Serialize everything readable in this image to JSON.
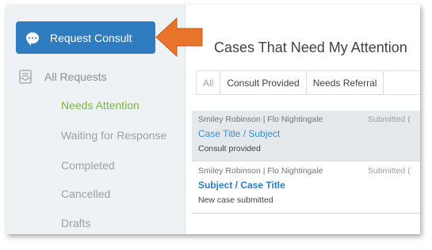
{
  "sidebar": {
    "request_button_label": "Request Consult",
    "all_requests_label": "All Requests",
    "items": [
      {
        "label": "Needs Attention",
        "active": true
      },
      {
        "label": "Waiting for Response",
        "active": false
      },
      {
        "label": "Completed",
        "active": false
      },
      {
        "label": "Cancelled",
        "active": false
      },
      {
        "label": "Drafts",
        "active": false
      }
    ]
  },
  "main": {
    "title": "Cases That Need My Attention",
    "tabs": [
      {
        "label": "All"
      },
      {
        "label": "Consult Provided"
      },
      {
        "label": "Needs Referral"
      }
    ],
    "cases": [
      {
        "meta": "Smiley Robinson | Flo Nightingale",
        "submitted": "Submitted (",
        "title": "Case Title / Subject",
        "status": "Consult provided"
      },
      {
        "meta": "Smiley Robinson | Flo Nightingale",
        "submitted": "Submitted (",
        "title": "Subject / Case Title",
        "status": "New case submitted"
      }
    ]
  },
  "colors": {
    "accent_blue": "#2f7cc1",
    "active_green": "#7ab63a",
    "arrow_orange": "#e8742c",
    "sidebar_bg": "#eef2f5"
  },
  "icons": {
    "request_button": "chat-bubble-icon",
    "all_requests": "inbox-icon",
    "callout": "arrow-left-icon"
  }
}
